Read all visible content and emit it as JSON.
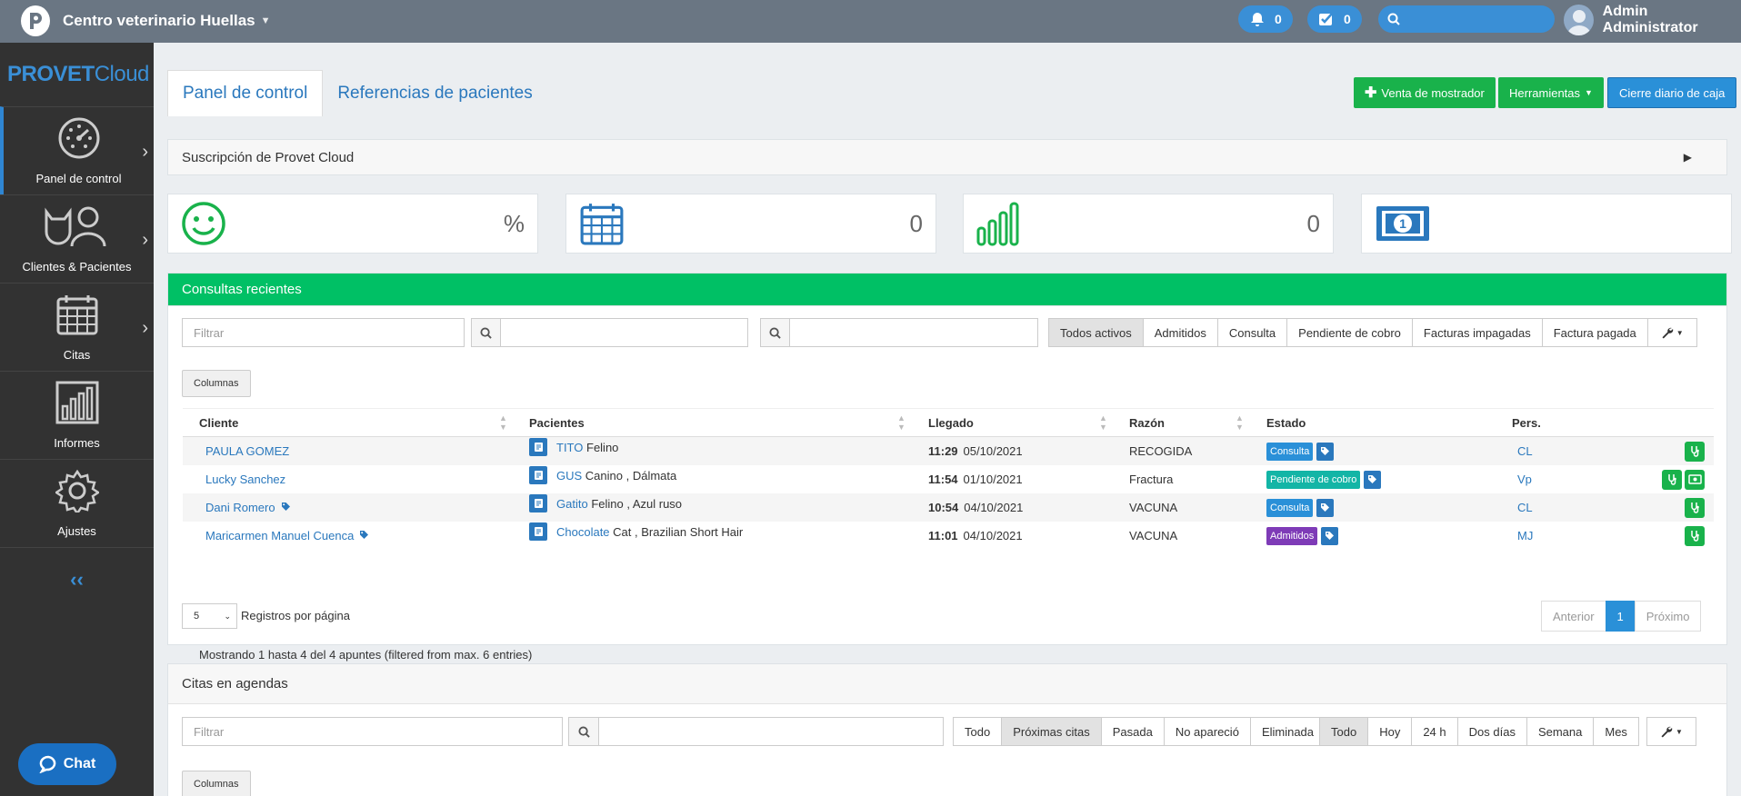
{
  "topbar": {
    "clinic_name": "Centro veterinario Huellas",
    "notifications_count": "0",
    "tasks_count": "0",
    "search_placeholder": "",
    "user_name": "Admin Administrator"
  },
  "sidebar": {
    "brand_bold": "PROVET",
    "brand_light": "Cloud",
    "items": [
      {
        "label": "Panel de control",
        "icon": "speedometer-icon"
      },
      {
        "label": "Clientes & Pacientes",
        "icon": "cat-person-icon"
      },
      {
        "label": "Citas",
        "icon": "calendar-icon"
      },
      {
        "label": "Informes",
        "icon": "bar-chart-icon"
      },
      {
        "label": "Ajustes",
        "icon": "gear-icon"
      }
    ],
    "collapse_label": "‹‹",
    "chat_label": "Chat"
  },
  "tabs": [
    "Panel de control",
    "Referencias de pacientes"
  ],
  "actions": {
    "counter_sale": "Venta de mostrador",
    "tools": "Herramientas",
    "daily_close": "Cierre diario de caja"
  },
  "subscription": {
    "title": "Suscripción de Provet Cloud"
  },
  "stat_cards": [
    {
      "icon": "smiley-icon",
      "value": "%"
    },
    {
      "icon": "calendar-icon",
      "value": "0"
    },
    {
      "icon": "bar-chart-icon",
      "value": "0"
    },
    {
      "icon": "money-icon",
      "value": ""
    }
  ],
  "recent": {
    "title": "Consultas recientes",
    "filter_placeholder": "Filtrar",
    "filters": [
      "Todos activos",
      "Admitidos",
      "Consulta",
      "Pendiente de cobro",
      "Facturas impagadas",
      "Factura pagada"
    ],
    "columns_button": "Columnas",
    "headers": [
      "Cliente",
      "Pacientes",
      "Llegado",
      "Razón",
      "Estado",
      "Pers."
    ],
    "rows": [
      {
        "client": "PAULA GOMEZ",
        "client_tag": false,
        "patient": "TITO",
        "species": "Felino",
        "time": "11:29",
        "date": "05/10/2021",
        "reason": "RECOGIDA",
        "status": "Consulta",
        "status_color": "#2a90d8",
        "staff": "CL",
        "cash": false
      },
      {
        "client": "Lucky Sanchez",
        "client_tag": false,
        "patient": "GUS",
        "species": "Canino , Dálmata",
        "time": "11:54",
        "date": "01/10/2021",
        "reason": "Fractura",
        "status": "Pendiente de cobro",
        "status_color": "#13b5a6",
        "staff": "Vp",
        "cash": true
      },
      {
        "client": "Dani Romero",
        "client_tag": true,
        "patient": "Gatito",
        "species": "Felino , Azul ruso",
        "time": "10:54",
        "date": "04/10/2021",
        "reason": "VACUNA",
        "status": "Consulta",
        "status_color": "#2a90d8",
        "staff": "CL",
        "cash": false
      },
      {
        "client": "Maricarmen Manuel Cuenca",
        "client_tag": true,
        "patient": "Chocolate",
        "species": "Cat , Brazilian Short Hair",
        "time": "11:01",
        "date": "04/10/2021",
        "reason": "VACUNA",
        "status": "Admitidos",
        "status_color": "#7e3bb7",
        "staff": "MJ",
        "cash": false
      }
    ],
    "page_size": "5",
    "per_page_label": "Registros por página",
    "pager": [
      "Anterior",
      "1",
      "Próximo"
    ],
    "summary": "Mostrando 1 hasta 4 del 4 apuntes (filtered from max. 6 entries)"
  },
  "appointments": {
    "title": "Citas en agendas",
    "filter_placeholder": "Filtrar",
    "filters1": [
      "Todo",
      "Próximas citas",
      "Pasada",
      "No apareció",
      "Eliminada"
    ],
    "filters2": [
      "Todo",
      "Hoy",
      "24 h",
      "Dos días",
      "Semana",
      "Mes"
    ],
    "columns_button": "Columnas"
  },
  "colors": {
    "accent": "#2a78bd",
    "green": "#00c065",
    "topbar": "#6a7683",
    "sidebar": "#323232"
  }
}
